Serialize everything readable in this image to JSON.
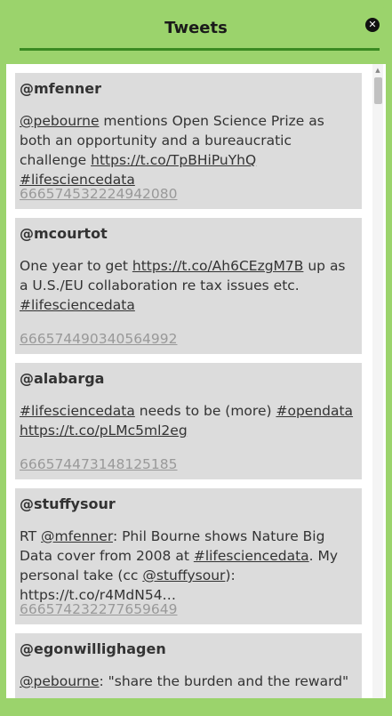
{
  "header": {
    "title": "Tweets"
  },
  "tweets": [
    {
      "user": "@mfenner",
      "segments": [
        {
          "t": "@pebourne",
          "link": true
        },
        {
          "t": " mentions Open Science Prize as both an opportunity and a bureaucratic challenge "
        },
        {
          "t": "https://t.co/TpBHiPuYhQ",
          "link": true
        },
        {
          "t": " "
        },
        {
          "t": "#lifesciencedata",
          "link": true
        }
      ],
      "id": "666574532224942080"
    },
    {
      "user": "@mcourtot",
      "segments": [
        {
          "t": "One year to get "
        },
        {
          "t": "https://t.co/Ah6CEzgM7B",
          "link": true
        },
        {
          "t": " up as a U.S./EU collaboration re tax issues etc. "
        },
        {
          "t": "#lifesciencedata",
          "link": true
        }
      ],
      "id": "666574490340564992"
    },
    {
      "user": "@alabarga",
      "segments": [
        {
          "t": "#lifesciencedata",
          "link": true
        },
        {
          "t": " needs to be (more) "
        },
        {
          "t": "#opendata",
          "link": true
        },
        {
          "t": " "
        },
        {
          "t": "https://t.co/pLMc5ml2eg",
          "link": true
        }
      ],
      "id": "666574473148125185"
    },
    {
      "user": "@stuffysour",
      "segments": [
        {
          "t": "RT "
        },
        {
          "t": "@mfenner",
          "link": true
        },
        {
          "t": ": Phil Bourne shows Nature Big Data cover from 2008 at "
        },
        {
          "t": "#lifesciencedata",
          "link": true
        },
        {
          "t": ". My personal take (cc "
        },
        {
          "t": "@stuffysour",
          "link": true
        },
        {
          "t": "): https://t.co/r4MdN54…"
        }
      ],
      "id": "666574232277659649"
    },
    {
      "user": "@egonwillighagen",
      "segments": [
        {
          "t": "@pebourne",
          "link": true
        },
        {
          "t": ": \"share the burden and the reward\""
        }
      ],
      "id": ""
    }
  ]
}
